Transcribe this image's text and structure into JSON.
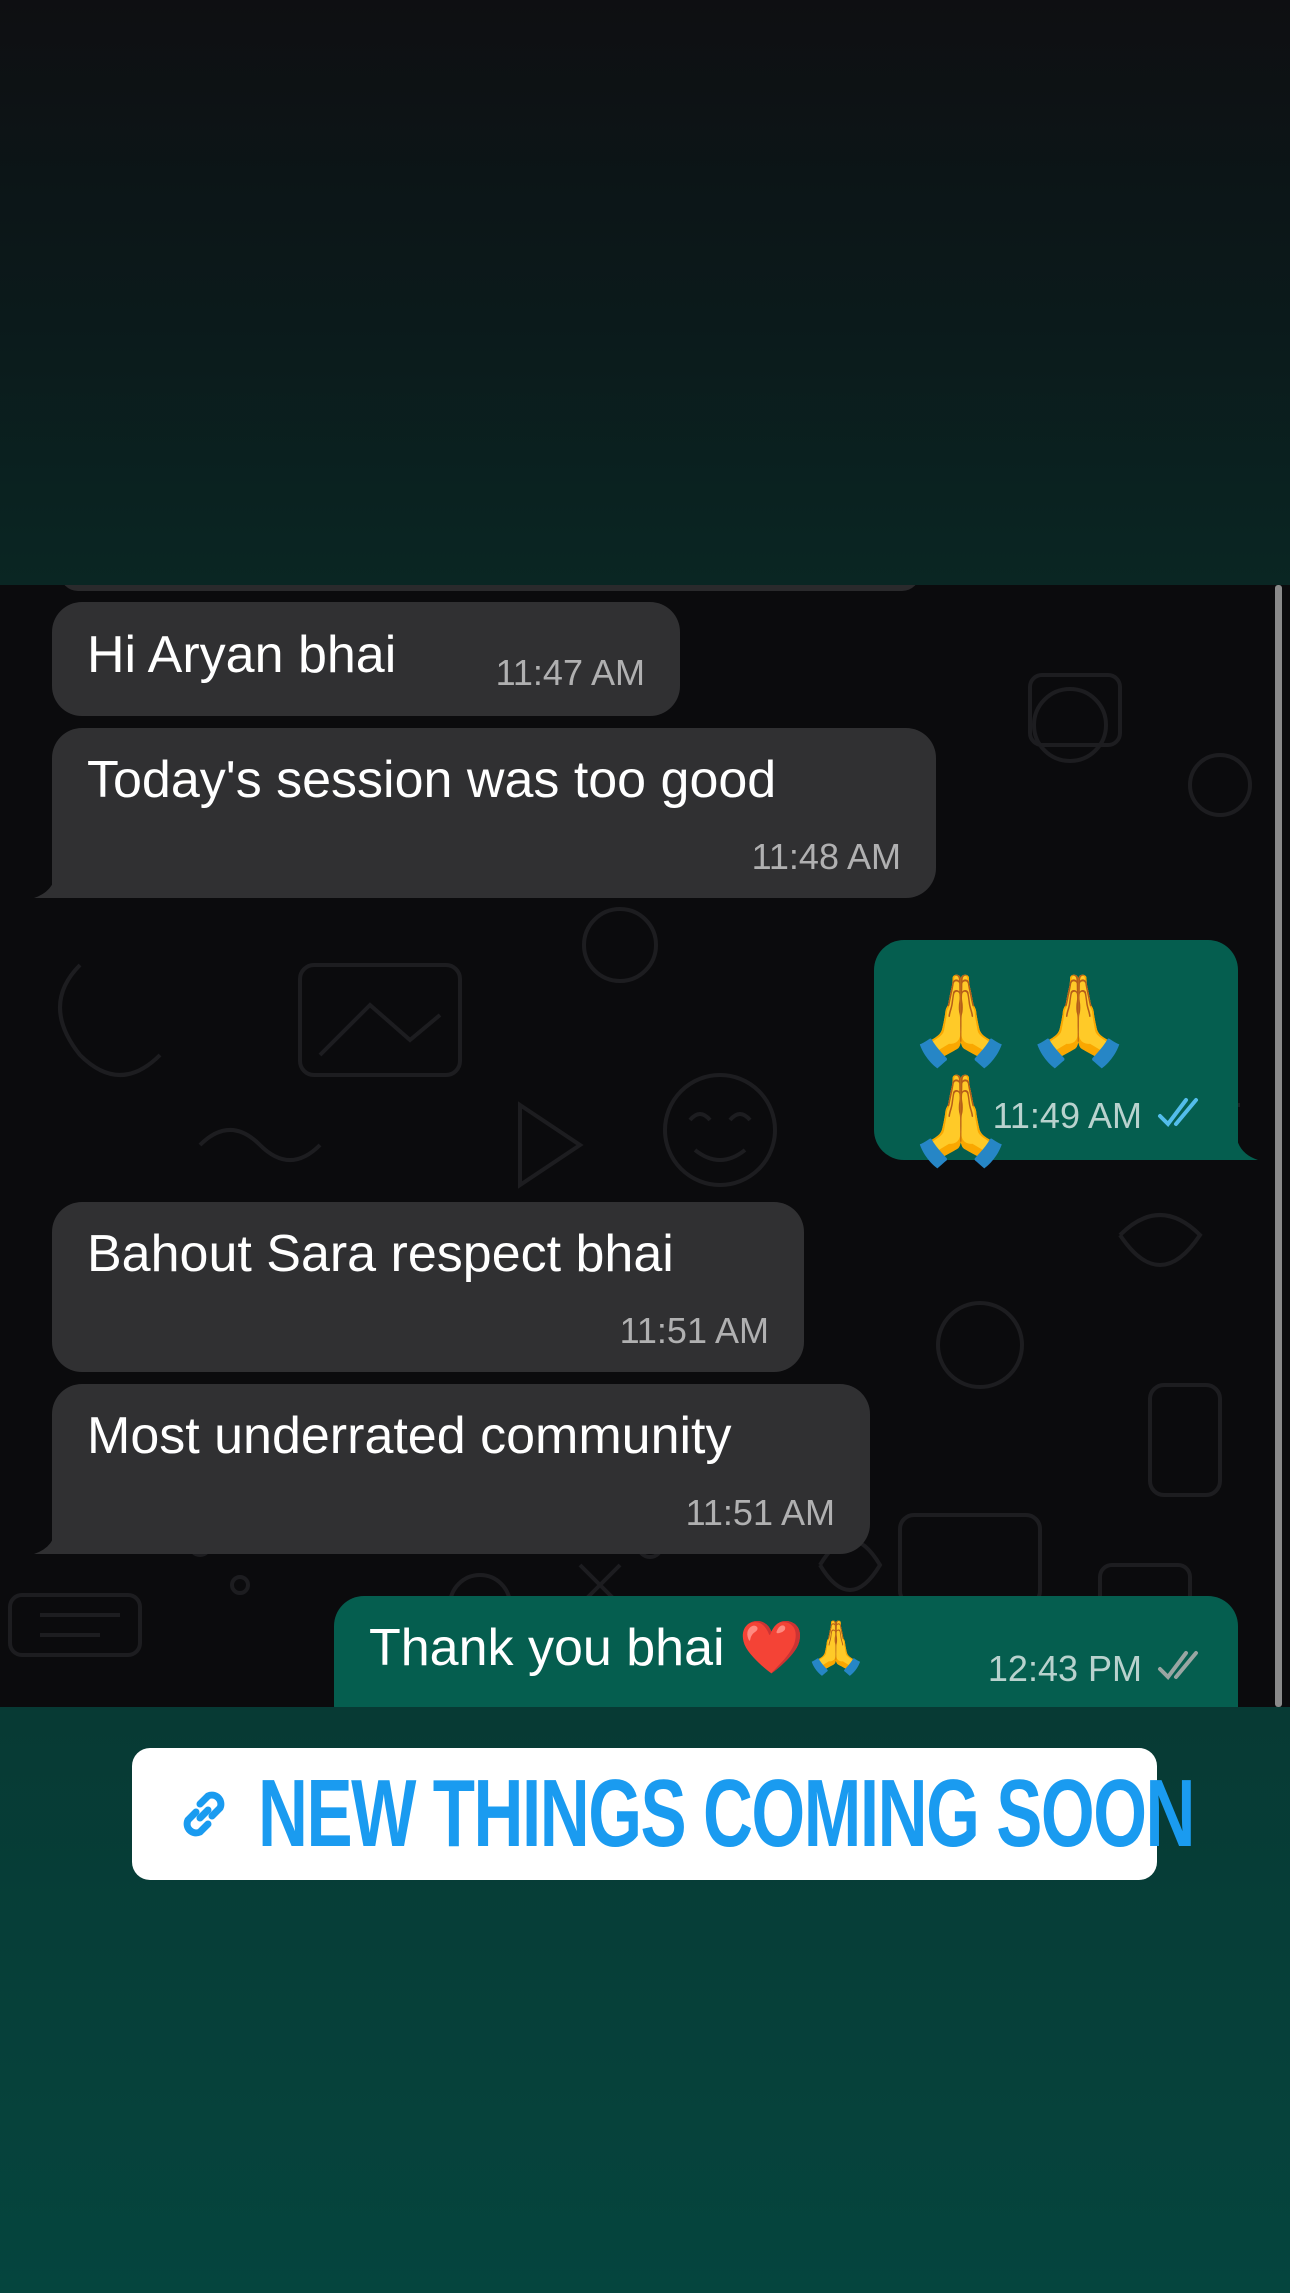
{
  "messages": [
    {
      "direction": "incoming",
      "text": "Hi Aryan bhai",
      "time": "11:47 AM"
    },
    {
      "direction": "incoming",
      "text": "Today's session was too good",
      "time": "11:48 AM"
    },
    {
      "direction": "outgoing",
      "text": "🙏🙏🙏",
      "time": "11:49 AM",
      "status": "read"
    },
    {
      "direction": "incoming",
      "text": "Bahout Sara respect bhai",
      "time": "11:51 AM"
    },
    {
      "direction": "incoming",
      "text": "Most underrated community",
      "time": "11:51 AM"
    },
    {
      "direction": "outgoing",
      "text": "Thank you bhai ❤️🙏",
      "time": "12:43 PM",
      "status": "delivered"
    }
  ],
  "sticker": {
    "icon": "link-icon",
    "label": "NEW THINGS COMING SOON"
  },
  "colors": {
    "incoming_bubble": "#303032",
    "outgoing_bubble": "#055e4f",
    "read_tick": "#53bdeb",
    "delivered_tick": "#9aa6a3",
    "sticker_text": "#1a9bf0"
  }
}
